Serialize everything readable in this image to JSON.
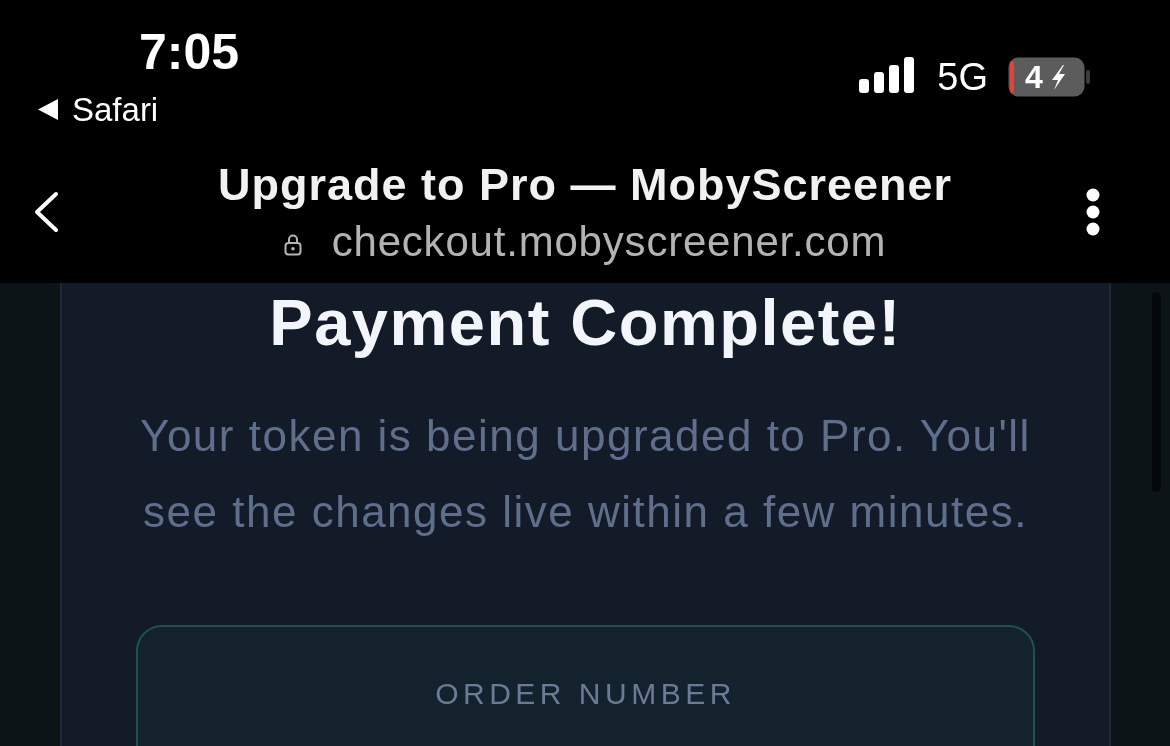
{
  "status_bar": {
    "time": "7:05",
    "back_app": "Safari",
    "network": "5G",
    "battery_percent": "4",
    "charging": true
  },
  "browser_bar": {
    "title": "Upgrade to Pro — MobyScreener",
    "url": "checkout.mobyscreener.com",
    "secure": true
  },
  "page": {
    "heading": "Payment Complete!",
    "message": "Your token is being upgraded to Pro. You'll see the changes live within a few minutes.",
    "order_box": {
      "label": "ORDER NUMBER"
    }
  }
}
